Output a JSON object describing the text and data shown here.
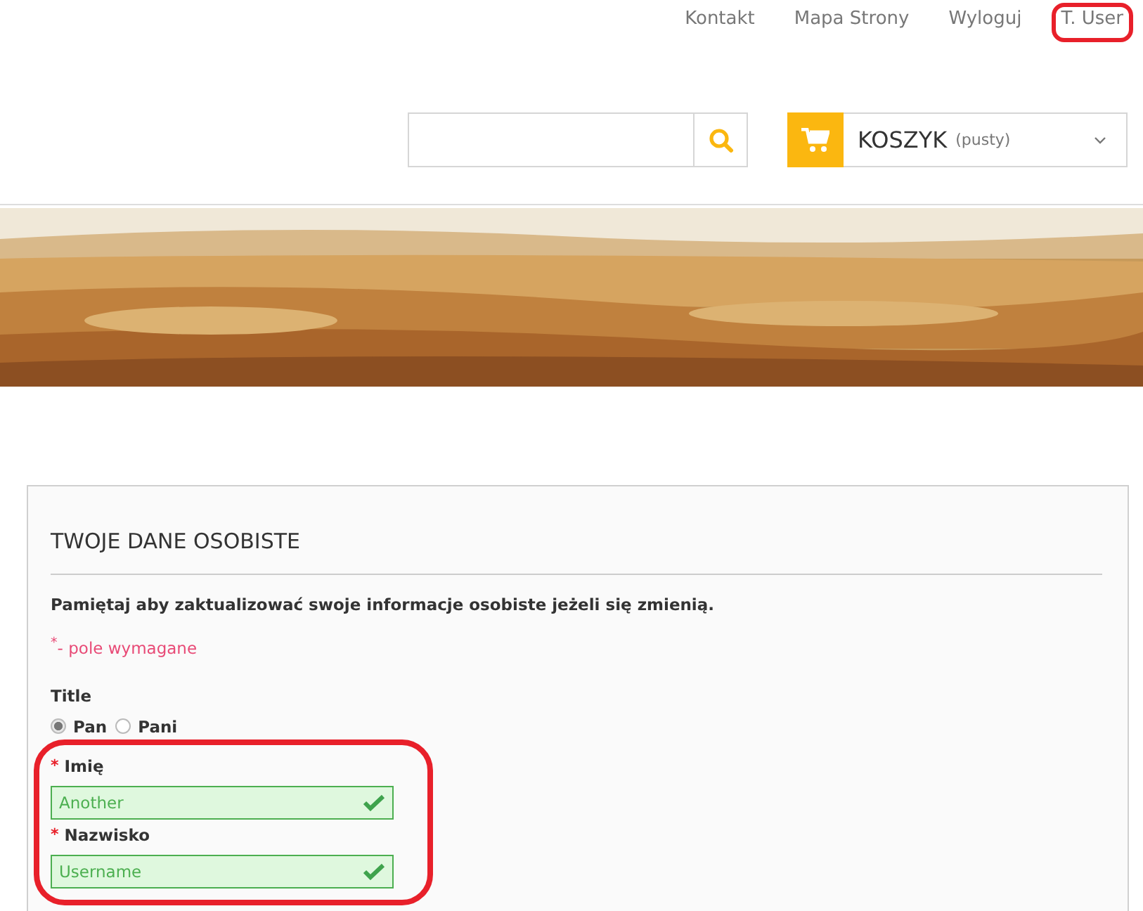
{
  "top_links": [
    {
      "label": "Kontakt",
      "highlighted": false
    },
    {
      "label": "Mapa Strony",
      "highlighted": false
    },
    {
      "label": "Wyloguj",
      "highlighted": false
    },
    {
      "label": "T. User",
      "highlighted": true
    }
  ],
  "cart": {
    "label": "KOSZYK",
    "status": "(pusty)"
  },
  "form": {
    "title": "TWOJE DANE OSOBISTE",
    "intro": "Pamiętaj aby zaktualizować swoje informacje osobiste jeżeli się zmienią.",
    "required_note": "$^{*}$- pole wymagane",
    "title_label": "Title",
    "title_options": [
      {
        "label": "Pan",
        "selected": true
      },
      {
        "label": "Pani",
        "selected": false
      }
    ],
    "fields": [
      {
        "required_mark": "*",
        "label": "Imię",
        "value": "Another",
        "valid": true
      },
      {
        "required_mark": "*",
        "label": "Nazwisko",
        "value": "Username",
        "valid": true
      }
    ],
    "fields_highlighted": true
  }
}
